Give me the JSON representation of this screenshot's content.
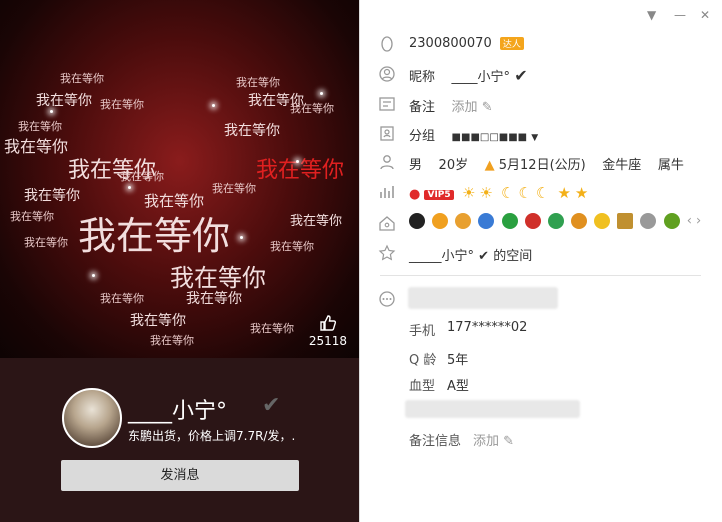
{
  "cover": {
    "heart_text": "我在等你",
    "like_count": "25118"
  },
  "profile": {
    "nickname": "____小宁°",
    "verified_mark": "✔",
    "signature": "东鹏出货，价格上调7.7R/发，.",
    "send_message_label": "发消息"
  },
  "window": {
    "menu_icon": "▼",
    "minimize_icon": "—",
    "close_icon": "✕"
  },
  "info": {
    "qq_number": "2300800070",
    "daren_label": "达人",
    "nickname_label": "昵称",
    "nickname_value": "____小宁°",
    "remark_label": "备注",
    "remark_action": "添加",
    "group_label": "分组",
    "group_value": "■■■□□■■■",
    "gender": "男",
    "age": "20岁",
    "birthday": "5月12日(公历)",
    "zodiac": "金牛座",
    "chinese_zodiac": "属牛",
    "vip_label": "VIP5",
    "space_name": "_____小宁°",
    "space_suffix": "的空间"
  },
  "details": {
    "phone_label": "手机",
    "phone_value": "177******02",
    "qage_label": "Q 龄",
    "qage_value": "5年",
    "blood_label": "血型",
    "blood_value": "A型",
    "remark_info_label": "备注信息",
    "remark_info_action": "添加"
  },
  "colors": {
    "accent_red": "#e02020",
    "vip_red": "#e02a2a",
    "daren_orange": "#f4a51c",
    "panel_dark": "#2b1516"
  }
}
